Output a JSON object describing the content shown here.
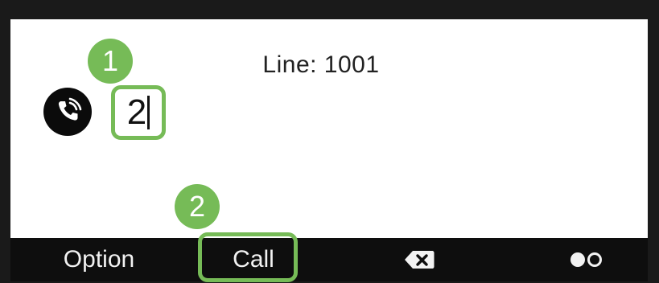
{
  "screen": {
    "line_label": "Line: 1001"
  },
  "dialer": {
    "input_value": "2",
    "phone_icon": "phone-handset-icon"
  },
  "annotations": {
    "step_1": "1",
    "step_2": "2",
    "highlight_color": "#76bb57"
  },
  "softkeys": {
    "option_label": "Option",
    "call_label": "Call",
    "backspace_icon": "backspace-icon",
    "toggle_icon": "page-toggle-icon"
  }
}
